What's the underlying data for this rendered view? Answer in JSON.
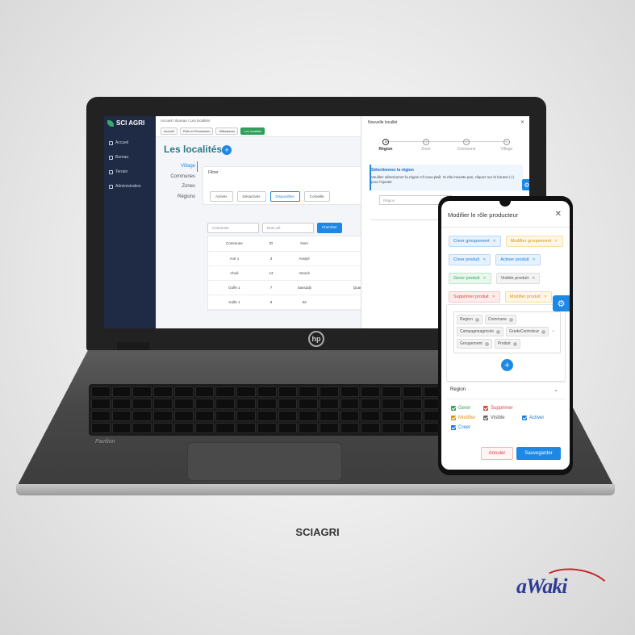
{
  "laptop": {
    "brand_mark": "hp",
    "model": "Pavilion",
    "app": {
      "logo": "SCI AGRI",
      "sidebar": [
        "Accueil",
        "Bureau",
        "Terrain",
        "Administration"
      ],
      "breadcrumb": "Accueil / Bureau / Les localités",
      "top_pills": [
        "Accueil",
        "Rôle et Permission",
        "Utilisateurs",
        "Les localités"
      ],
      "page_title": "Les localités",
      "left_nav": [
        "Village",
        "Communes",
        "Zones",
        "Régions"
      ],
      "filter_title": "Filtrer",
      "filter_buttons": [
        "Activés",
        "Désactivés",
        "Disponibles",
        "Corbeille"
      ],
      "search_placeholders": [
        "Commune",
        "Nom,clé"
      ],
      "search_button": "Chercher",
      "table": {
        "headers": [
          "Commune",
          "ID",
          "Nom",
          ""
        ],
        "rows": [
          [
            "Aoé 1",
            "3",
            "Assiyé",
            "Assiyé"
          ],
          [
            "Ahoé",
            "13",
            "Atsovè",
            ""
          ],
          [
            "Golfe 1",
            "7",
            "Sassadji",
            "Quartier populeux"
          ],
          [
            "Golfe 1",
            "9",
            "Sè",
            "le ca"
          ]
        ]
      }
    },
    "modal": {
      "title": "Nouvelle localité",
      "steps": [
        "Région",
        "Zone",
        "Commune",
        "Village"
      ],
      "info_title": "Sélectionnez la région",
      "info_text": "Veuillez sélectionner la région s'il vous plaît. Si elle inexiste pas, cliquez sur le bouton (+) pour l'ajouter",
      "region_placeholder": "Région"
    }
  },
  "phone": {
    "title": "Modifier le rôle producteur",
    "tags": [
      [
        {
          "label": "Creer groupement",
          "color": "blue"
        },
        {
          "label": "Modifier groupement",
          "color": "yellow"
        }
      ],
      [
        {
          "label": "Creer produit",
          "color": "blue"
        },
        {
          "label": "Activer produit",
          "color": "blue"
        }
      ],
      [
        {
          "label": "Gerer produit",
          "color": "green"
        },
        {
          "label": "Visible produit",
          "color": "gray"
        }
      ],
      [
        {
          "label": "Supprimer produit",
          "color": "red"
        },
        {
          "label": "Modifier produit",
          "color": "yellow"
        }
      ]
    ],
    "chips": [
      "Region",
      "Commune",
      "Campagneagricole",
      "GradeControleur",
      "Groupement",
      "Produit"
    ],
    "section": "Region",
    "permissions": [
      {
        "label": "Gerer",
        "color": "#2fa35a"
      },
      {
        "label": "Supprimer",
        "color": "#d64545"
      },
      {
        "label": "",
        "color": ""
      },
      {
        "label": "Modifier",
        "color": "#d9950f"
      },
      {
        "label": "Visible",
        "color": "#555555"
      },
      {
        "label": "Activer",
        "color": "#1e7be0"
      },
      {
        "label": "Creer",
        "color": "#1e7be0"
      }
    ],
    "cancel": "Annuler",
    "save": "Sauvegarder"
  },
  "caption": "SCIAGRI",
  "brand": "aWaki"
}
